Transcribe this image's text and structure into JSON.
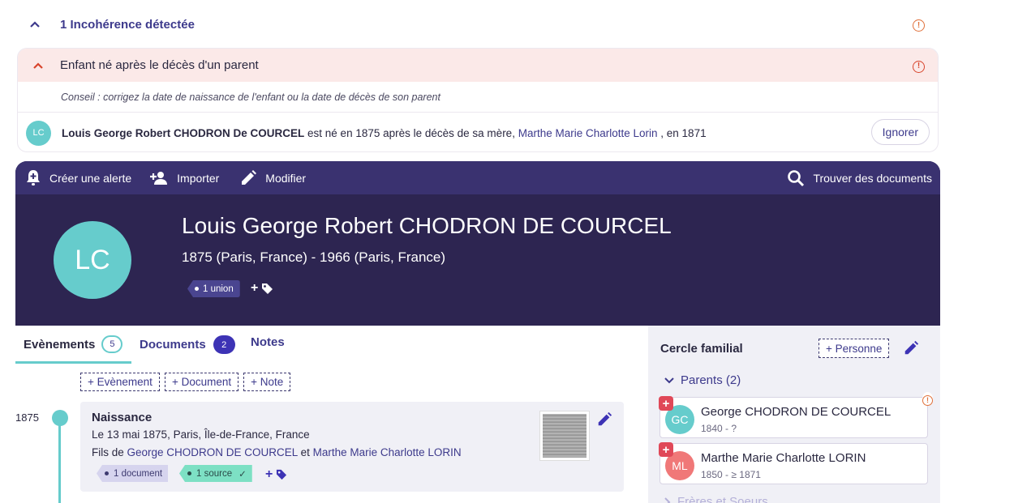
{
  "incoherence": {
    "summary": "1 Incohérence détectée",
    "issue_title": "Enfant né après le décès d'un parent",
    "advice": "Conseil : corrigez la date de naissance de l'enfant ou la date de décès de son parent",
    "person_initials": "LC",
    "person_name": "Louis George Robert CHODRON De COURCEL",
    "sentence_mid": " est né en 1875 après le décès de sa mère, ",
    "mother_link": "Marthe Marie Charlotte Lorin",
    "sentence_end": " , en 1871",
    "ignore_label": "Ignorer"
  },
  "toolbar": {
    "create_alert": "Créer une alerte",
    "import": "Importer",
    "edit": "Modifier",
    "find_documents": "Trouver des documents"
  },
  "profile": {
    "initials": "LC",
    "name": "Louis George Robert CHODRON DE COURCEL",
    "dates": "1875 (Paris, France) - 1966 (Paris, France)",
    "union_tag": "1 union",
    "add_label": "+"
  },
  "tabs": {
    "events": "Evènements",
    "events_count": "5",
    "documents": "Documents",
    "documents_count": "2",
    "notes": "Notes"
  },
  "add_buttons": {
    "event": "+ Evènement",
    "document": "+ Document",
    "note": "+ Note"
  },
  "timeline": {
    "year": "1875",
    "event": {
      "title": "Naissance",
      "date_place": "Le 13 mai 1875, Paris, Île-de-France, France",
      "parents_prefix": "Fils de ",
      "father": "George CHODRON DE COURCEL",
      "and": " et ",
      "mother": "Marthe Marie Charlotte LORIN",
      "doc_tag": "1 document",
      "source_tag": "1 source",
      "add_label": "+"
    }
  },
  "family": {
    "title": "Cercle familial",
    "add_person": "+ Personne",
    "parents_label": "Parents (2)",
    "parents": [
      {
        "initials": "GC",
        "name": "George CHODRON DE COURCEL",
        "dates": "1840 - ?",
        "color": "#66cccc"
      },
      {
        "initials": "ML",
        "name": "Marthe Marie Charlotte LORIN",
        "dates": "1850 - ≥ 1871",
        "color": "#f07878"
      }
    ],
    "siblings_label": "Frères et Soeurs"
  },
  "colors": {
    "accent": "#3d3a8c",
    "banner": "#2d2551",
    "teal": "#66cccc",
    "warning": "#e0703a",
    "error_bg": "#fbe9e8"
  }
}
